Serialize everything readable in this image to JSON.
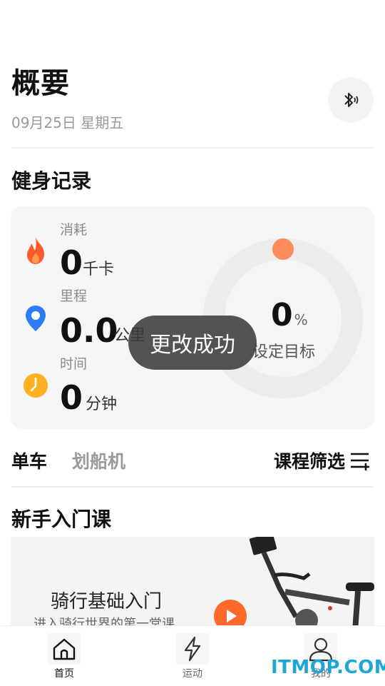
{
  "header": {
    "title": "概要",
    "date": "09月25日 星期五"
  },
  "fitness": {
    "section_title": "健身记录",
    "stats": [
      {
        "label": "消耗",
        "value": "0",
        "unit": "千卡",
        "icon": "flame-icon",
        "color": "#ff5a2a"
      },
      {
        "label": "里程",
        "value": "0.0",
        "unit": "公里",
        "icon": "location-pin-icon",
        "color": "#2f7cf6"
      },
      {
        "label": "时间",
        "value": "0",
        "unit": "分钟",
        "icon": "clock-icon",
        "color": "#ffb020"
      }
    ],
    "goal": {
      "percent": "0",
      "percent_sign": "%",
      "label": "设定目标",
      "progress_fraction": 0,
      "accent_color": "#ff8a5c"
    }
  },
  "toast": "更改成功",
  "tabs": {
    "items": [
      "单车",
      "划船机"
    ],
    "active": "单车",
    "filter_label": "课程筛选"
  },
  "beginner": {
    "section_title": "新手入门课",
    "course_title": "骑行基础入门",
    "course_subtitle": "进入骑行世界的第一堂课"
  },
  "bottom_nav": [
    {
      "label": "首页",
      "icon": "home-icon",
      "active": true
    },
    {
      "label": "运动",
      "icon": "lightning-icon",
      "active": false
    },
    {
      "label": "我的",
      "icon": "profile-icon",
      "active": false
    }
  ],
  "watermark": "ITMOP.COM",
  "colors": {
    "accent": "#ff8a5c",
    "watermark": "#1fa6d6",
    "play_button": "#ff6a2a"
  }
}
